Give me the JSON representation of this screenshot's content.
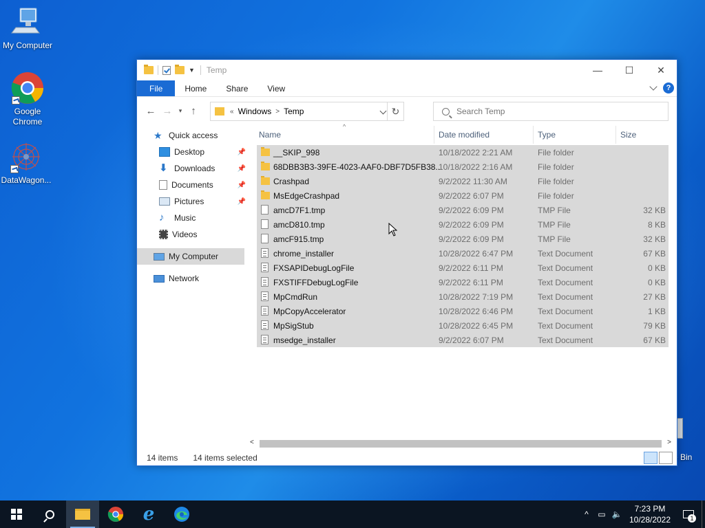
{
  "desktop": {
    "icons": [
      {
        "label": "My Computer",
        "icon": "monitor-icon"
      },
      {
        "label": "Google Chrome",
        "icon": "chrome-icon"
      },
      {
        "label": "DataWagon...",
        "icon": "datawagon-icon"
      }
    ],
    "recycle_partial_label": "e Bin"
  },
  "window": {
    "title": "Temp",
    "ribbon_tabs": [
      "File",
      "Home",
      "Share",
      "View"
    ],
    "help_label": "?",
    "address": {
      "overflow": "«",
      "crumbs": [
        "Windows",
        "Temp"
      ]
    },
    "search_placeholder": "Search Temp",
    "nav": {
      "quick_access": "Quick access",
      "items": [
        {
          "label": "Desktop",
          "pinned": true
        },
        {
          "label": "Downloads",
          "pinned": true
        },
        {
          "label": "Documents",
          "pinned": true
        },
        {
          "label": "Pictures",
          "pinned": true
        },
        {
          "label": "Music",
          "pinned": false
        },
        {
          "label": "Videos",
          "pinned": false
        }
      ],
      "my_computer": "My Computer",
      "network": "Network"
    },
    "columns": {
      "name": "Name",
      "date": "Date modified",
      "type": "Type",
      "size": "Size"
    },
    "files": [
      {
        "name": "__SKIP_998",
        "date": "10/18/2022 2:21 AM",
        "type": "File folder",
        "size": "",
        "kind": "folder"
      },
      {
        "name": "68DBB3B3-39FE-4023-AAF0-DBF7D5FB38...",
        "date": "10/18/2022 2:16 AM",
        "type": "File folder",
        "size": "",
        "kind": "folder"
      },
      {
        "name": "Crashpad",
        "date": "9/2/2022 11:30 AM",
        "type": "File folder",
        "size": "",
        "kind": "folder"
      },
      {
        "name": "MsEdgeCrashpad",
        "date": "9/2/2022 6:07 PM",
        "type": "File folder",
        "size": "",
        "kind": "folder"
      },
      {
        "name": "amcD7F1.tmp",
        "date": "9/2/2022 6:09 PM",
        "type": "TMP File",
        "size": "32 KB",
        "kind": "tmp"
      },
      {
        "name": "amcD810.tmp",
        "date": "9/2/2022 6:09 PM",
        "type": "TMP File",
        "size": "8 KB",
        "kind": "tmp"
      },
      {
        "name": "amcF915.tmp",
        "date": "9/2/2022 6:09 PM",
        "type": "TMP File",
        "size": "32 KB",
        "kind": "tmp"
      },
      {
        "name": "chrome_installer",
        "date": "10/28/2022 6:47 PM",
        "type": "Text Document",
        "size": "67 KB",
        "kind": "text"
      },
      {
        "name": "FXSAPIDebugLogFile",
        "date": "9/2/2022 6:11 PM",
        "type": "Text Document",
        "size": "0 KB",
        "kind": "text"
      },
      {
        "name": "FXSTIFFDebugLogFile",
        "date": "9/2/2022 6:11 PM",
        "type": "Text Document",
        "size": "0 KB",
        "kind": "text"
      },
      {
        "name": "MpCmdRun",
        "date": "10/28/2022 7:19 PM",
        "type": "Text Document",
        "size": "27 KB",
        "kind": "text"
      },
      {
        "name": "MpCopyAccelerator",
        "date": "10/28/2022 6:46 PM",
        "type": "Text Document",
        "size": "1 KB",
        "kind": "text"
      },
      {
        "name": "MpSigStub",
        "date": "10/28/2022 6:45 PM",
        "type": "Text Document",
        "size": "79 KB",
        "kind": "text"
      },
      {
        "name": "msedge_installer",
        "date": "9/2/2022 6:07 PM",
        "type": "Text Document",
        "size": "67 KB",
        "kind": "text"
      }
    ],
    "status": {
      "items": "14 items",
      "selected": "14 items selected"
    }
  },
  "taskbar": {
    "clock_time": "7:23 PM",
    "clock_date": "10/28/2022",
    "notification_count": "1"
  },
  "colors": {
    "accent": "#1a6bd4",
    "folder": "#f5c242",
    "selection": "#d9d9d9"
  }
}
